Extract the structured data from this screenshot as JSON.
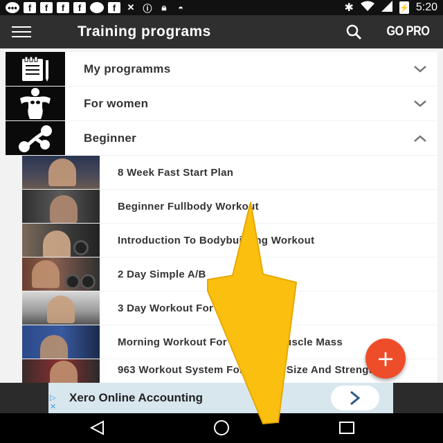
{
  "status_bar": {
    "icons": [
      "messages-icon",
      "facebook-icon",
      "facebook-icon",
      "facebook-icon",
      "facebook-icon",
      "chat-icon",
      "facebook-icon",
      "fitness-icon",
      "info-icon",
      "lock-icon",
      "android-icon"
    ],
    "bluetooth": "✱",
    "time": "5:20"
  },
  "app_bar": {
    "title": "Training programs",
    "go_pro": "GO PRO"
  },
  "categories": [
    {
      "label": "My programms",
      "icon": "notepad-icon",
      "expanded": false
    },
    {
      "label": "For women",
      "icon": "woman-figure-icon",
      "expanded": false
    },
    {
      "label": "Beginner",
      "icon": "share-nodes-icon",
      "expanded": true
    }
  ],
  "programs": [
    {
      "label": "8 Week Fast Start Plan"
    },
    {
      "label": "Beginner Fullbody Workout"
    },
    {
      "label": "Introduction To Bodybuilding Workout"
    },
    {
      "label": "2 Day Simple A/B"
    },
    {
      "label": "3 Day Workout For Beginners"
    },
    {
      "label": "Morning Workout For Building Muscle Mass"
    },
    {
      "label": "963 Workout System For Muscle Size And Strength"
    }
  ],
  "fab": {
    "label": "+"
  },
  "ad": {
    "text": "Xero Online Accounting"
  },
  "colors": {
    "app_bar": "#2f2f2f",
    "accent": "#ee4d2a",
    "overlay_arrow": "#fbbf10"
  }
}
